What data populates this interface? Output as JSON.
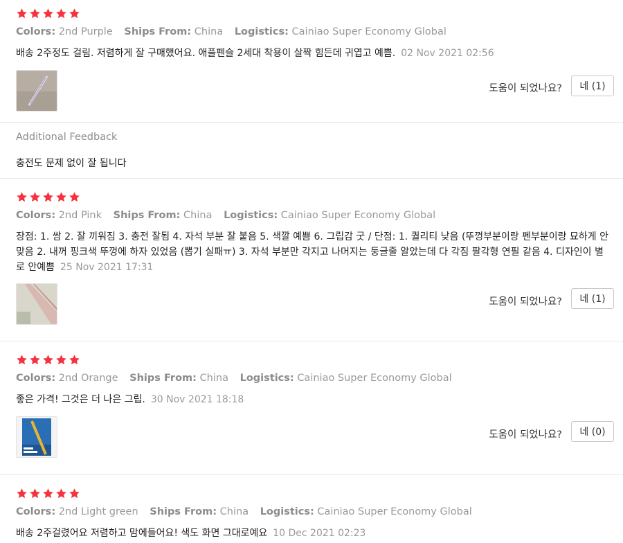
{
  "labels": {
    "colors": "Colors:",
    "ships_from": "Ships From:",
    "logistics": "Logistics:",
    "helpful_question": "도움이 되었나요?",
    "additional_feedback": "Additional Feedback"
  },
  "reviews": [
    {
      "rating": 5,
      "color": "2nd Purple",
      "ships_from": "China",
      "logistics": "Cainiao Super Economy Global",
      "text": "배송 2주정도 걸림. 저렴하게 잘 구매했어요. 애플펜슬 2세대 착용이 살짝 힘든데 귀엽고 예쁨.",
      "date": "02 Nov 2021 02:56",
      "helpful_button": "네 (1)",
      "additional_feedback_text": "충전도 문제 없이 잘 됩니다"
    },
    {
      "rating": 5,
      "color": "2nd Pink",
      "ships_from": "China",
      "logistics": "Cainiao Super Economy Global",
      "text": "장점: 1. 쌈 2. 잘 끼워짐 3. 충전 잘됨 4. 자석 부분 잘 붙음 5. 색깔 예쁨 6. 그립감 굿 / 단점: 1. 퀄리티 낮음 (뚜껑부분이랑 펜부분이랑 묘하게 안맞음 2. 내꺼 핑크색 뚜껑에 하자 있었음 (뽑기 실패ㅠ) 3. 자석 부분만 각지고 나머지는 둥글줄 알았는데 다 각짐 팔각형 연필 같음 4. 디자인이 별로 안예쁨",
      "date": "25 Nov 2021 17:31",
      "helpful_button": "네 (1)"
    },
    {
      "rating": 5,
      "color": "2nd Orange",
      "ships_from": "China",
      "logistics": "Cainiao Super Economy Global",
      "text": "좋은 가격! 그것은 더 나은 그립.",
      "date": "30 Nov 2021 18:18",
      "helpful_button": "네 (0)"
    },
    {
      "rating": 5,
      "color": "2nd Light green",
      "ships_from": "China",
      "logistics": "Cainiao Super Economy Global",
      "text": "배송 2주걸렸어요 저렴하고 맘에들어요! 색도 화면 그대로예요",
      "date": "10 Dec 2021 02:23"
    }
  ],
  "colors": {
    "star": "#f5333f",
    "meta_text": "#999999",
    "divider": "#e8e8e8"
  },
  "icons": {
    "star": "star-icon"
  }
}
